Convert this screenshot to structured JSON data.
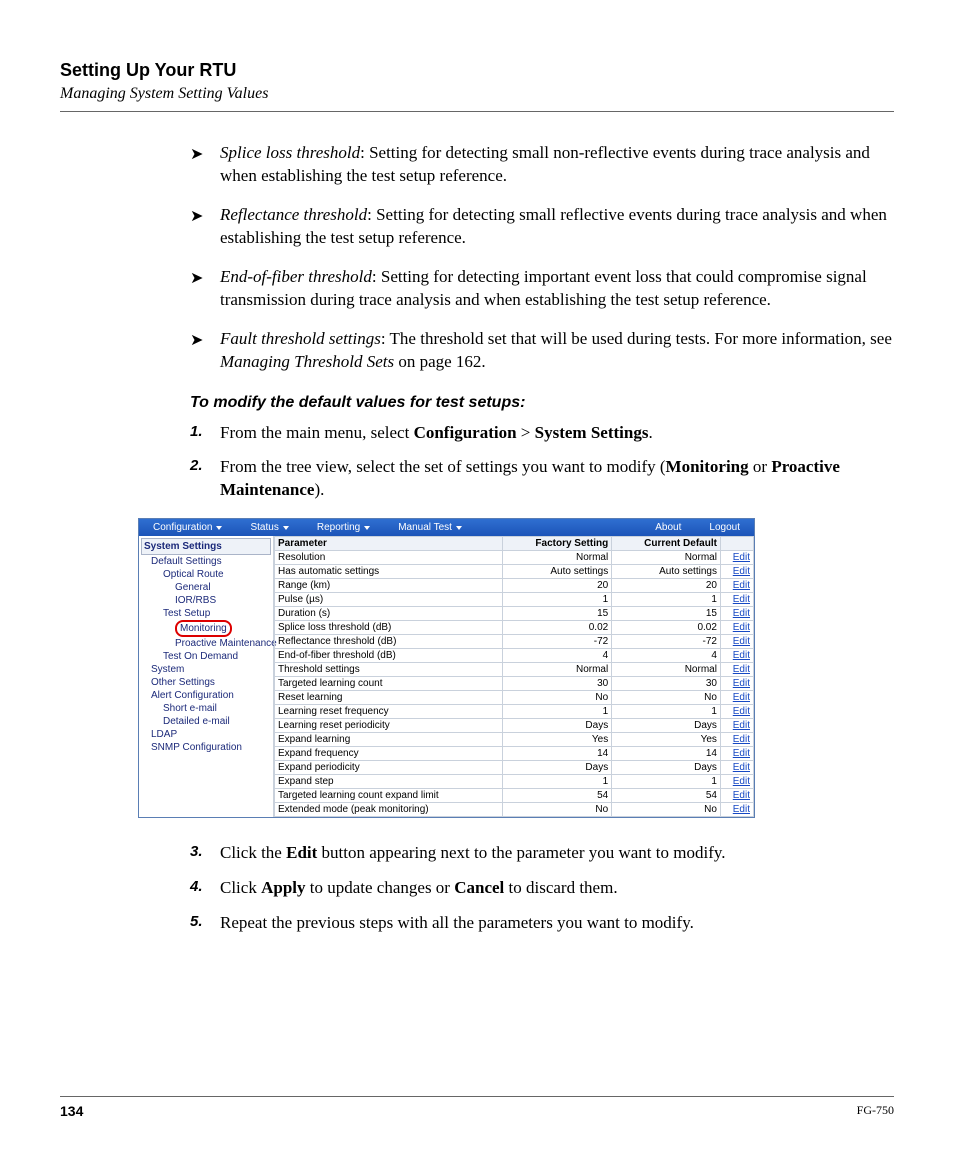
{
  "header": {
    "title": "Setting Up Your RTU",
    "subtitle": "Managing System Setting Values"
  },
  "bullets": [
    {
      "term": "Splice loss threshold",
      "desc": ": Setting for detecting small non-reflective events during trace analysis and when establishing the test setup reference."
    },
    {
      "term": "Reflectance threshold",
      "desc": ": Setting for detecting small reflective events during trace analysis and when establishing the test setup reference."
    },
    {
      "term": "End-of-fiber threshold",
      "desc": ": Setting for detecting important event loss that could compromise signal transmission during trace analysis and when establishing the test setup reference."
    },
    {
      "term": "Fault threshold settings",
      "desc": ": The threshold set that will be used during tests. For more information, see ",
      "ref": "Managing Threshold Sets",
      "tail": " on page 162."
    }
  ],
  "proc_heading": "To modify the default values for test setups:",
  "steps_top": [
    {
      "n": "1.",
      "pre": "From the main menu, select ",
      "b1": "Configuration",
      "mid": " > ",
      "b2": "System Settings",
      "post": "."
    },
    {
      "n": "2.",
      "pre": "From the tree view, select the set of settings you want to modify (",
      "b1": "Monitoring",
      "mid": " or ",
      "b2": "Proactive Maintenance",
      "post": ")."
    }
  ],
  "menubar": {
    "configuration": "Configuration",
    "status": "Status",
    "reporting": "Reporting",
    "manual_test": "Manual Test",
    "about": "About",
    "logout": "Logout"
  },
  "tree": {
    "root": "System Settings",
    "items": [
      {
        "lvl": 1,
        "label": "Default Settings"
      },
      {
        "lvl": 2,
        "label": "Optical Route"
      },
      {
        "lvl": 3,
        "label": "General"
      },
      {
        "lvl": 3,
        "label": "IOR/RBS"
      },
      {
        "lvl": 2,
        "label": "Test Setup"
      },
      {
        "lvl": 3,
        "label": "Monitoring",
        "sel": true
      },
      {
        "lvl": 3,
        "label": "Proactive Maintenance"
      },
      {
        "lvl": 2,
        "label": "Test On Demand"
      },
      {
        "lvl": 1,
        "label": "System"
      },
      {
        "lvl": 1,
        "label": "Other Settings"
      },
      {
        "lvl": 1,
        "label": "Alert Configuration"
      },
      {
        "lvl": 2,
        "label": "Short e-mail"
      },
      {
        "lvl": 2,
        "label": "Detailed e-mail"
      },
      {
        "lvl": 1,
        "label": "LDAP"
      },
      {
        "lvl": 1,
        "label": "SNMP Configuration"
      }
    ]
  },
  "grid": {
    "headers": {
      "param": "Parameter",
      "factory": "Factory Setting",
      "current": "Current Default"
    },
    "edit_label": "Edit",
    "rows": [
      {
        "p": "Resolution",
        "f": "Normal",
        "c": "Normal"
      },
      {
        "p": "Has automatic settings",
        "f": "Auto settings",
        "c": "Auto settings"
      },
      {
        "p": "Range (km)",
        "f": "20",
        "c": "20"
      },
      {
        "p": "Pulse (µs)",
        "f": "1",
        "c": "1"
      },
      {
        "p": "Duration (s)",
        "f": "15",
        "c": "15"
      },
      {
        "p": "Splice loss threshold (dB)",
        "f": "0.02",
        "c": "0.02"
      },
      {
        "p": "Reflectance threshold (dB)",
        "f": "-72",
        "c": "-72"
      },
      {
        "p": "End-of-fiber threshold (dB)",
        "f": "4",
        "c": "4"
      },
      {
        "p": "Threshold settings",
        "f": "Normal",
        "c": "Normal"
      },
      {
        "p": "Targeted learning count",
        "f": "30",
        "c": "30"
      },
      {
        "p": "Reset learning",
        "f": "No",
        "c": "No"
      },
      {
        "p": "Learning reset frequency",
        "f": "1",
        "c": "1"
      },
      {
        "p": "Learning reset periodicity",
        "f": "Days",
        "c": "Days"
      },
      {
        "p": "Expand learning",
        "f": "Yes",
        "c": "Yes"
      },
      {
        "p": "Expand frequency",
        "f": "14",
        "c": "14"
      },
      {
        "p": "Expand periodicity",
        "f": "Days",
        "c": "Days"
      },
      {
        "p": "Expand step",
        "f": "1",
        "c": "1"
      },
      {
        "p": "Targeted learning count expand limit",
        "f": "54",
        "c": "54"
      },
      {
        "p": "Extended mode (peak monitoring)",
        "f": "No",
        "c": "No"
      }
    ]
  },
  "steps_bottom": [
    {
      "n": "3.",
      "pre": "Click the ",
      "b1": "Edit",
      "post": " button appearing next to the parameter you want to modify."
    },
    {
      "n": "4.",
      "pre": "Click ",
      "b1": "Apply",
      "mid": " to update changes or ",
      "b2": "Cancel",
      "post": " to discard them."
    },
    {
      "n": "5.",
      "pre": "Repeat the previous steps with all the parameters you want to modify.",
      "b1": "",
      "post": ""
    }
  ],
  "footer": {
    "page": "134",
    "doc": "FG-750"
  }
}
